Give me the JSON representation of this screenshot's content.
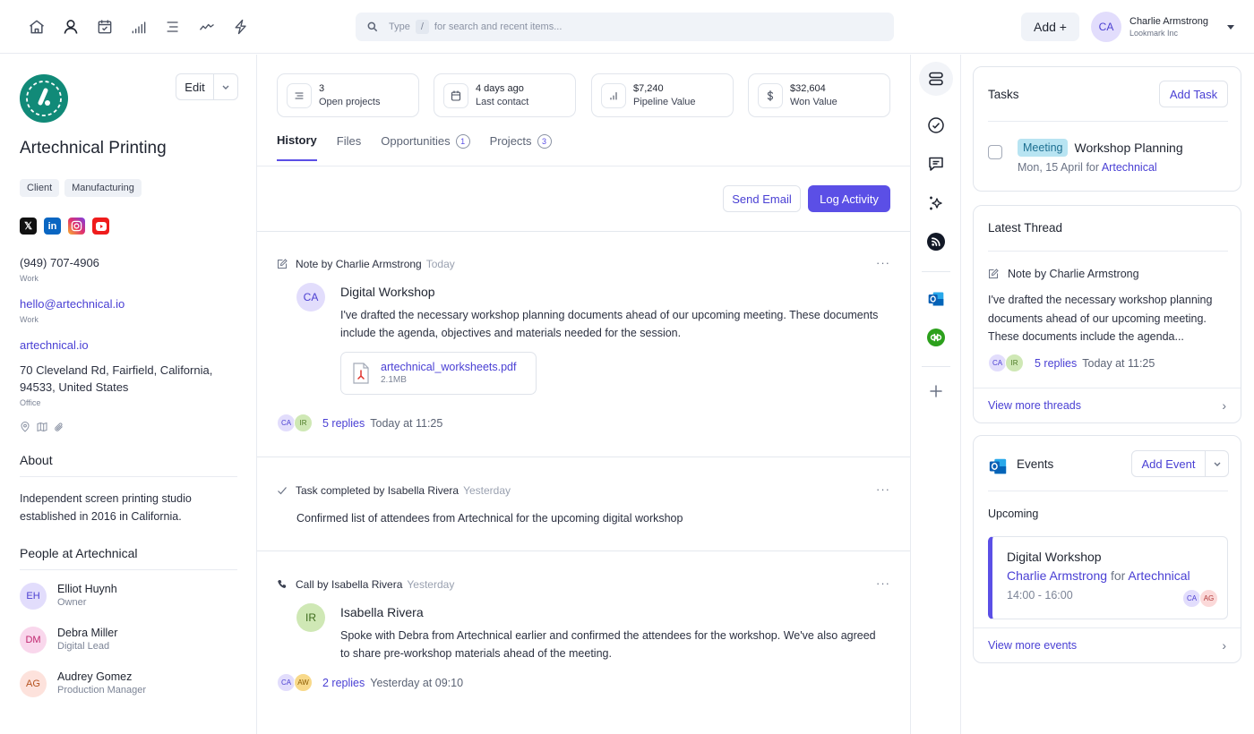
{
  "topbar": {
    "nav_icons": [
      "home-icon",
      "person-icon",
      "calendar-check-icon",
      "bar-chart-icon",
      "list-icon",
      "activity-icon",
      "lightning-icon"
    ],
    "search": {
      "prefix": "Type",
      "shortcut": "/",
      "placeholder": "for search and recent items..."
    },
    "add_label": "Add +",
    "user": {
      "initials": "CA",
      "name": "Charlie Armstrong",
      "org": "Lookmark Inc"
    }
  },
  "company": {
    "name": "Artechnical Printing",
    "logo_color": "#118a78",
    "edit_label": "Edit",
    "tags": [
      "Client",
      "Manufacturing"
    ],
    "socials": [
      "x",
      "linkedin",
      "instagram",
      "youtube"
    ],
    "phone": {
      "value": "(949) 707-4906",
      "label": "Work"
    },
    "email": {
      "value": "hello@artechnical.io",
      "label": "Work"
    },
    "website": "artechnical.io",
    "address": {
      "line1": "70 Cleveland Rd, Fairfield, California,",
      "line2": "94533, United States",
      "label": "Office"
    },
    "about_heading": "About",
    "about": "Independent screen printing studio established in 2016 in California.",
    "people_heading": "People at Artechnical",
    "people": [
      {
        "initials": "EH",
        "name": "Elliot Huynh",
        "role": "Owner",
        "bg": "#e2ddfc",
        "fg": "#4b3fd1"
      },
      {
        "initials": "DM",
        "name": "Debra Miller",
        "role": "Digital Lead",
        "bg": "#f9d7ec",
        "fg": "#c0266f"
      },
      {
        "initials": "AG",
        "name": "Audrey Gomez",
        "role": "Production Manager",
        "bg": "#fde2dc",
        "fg": "#b5521f"
      }
    ]
  },
  "stats": [
    {
      "icon": "list-icon",
      "value": "3",
      "label": "Open projects"
    },
    {
      "icon": "calendar-icon",
      "value": "4 days ago",
      "label": "Last contact"
    },
    {
      "icon": "bar-chart-icon",
      "value": "$7,240",
      "label": "Pipeline Value"
    },
    {
      "icon": "dollar-icon",
      "value": "$32,604",
      "label": "Won Value"
    }
  ],
  "tabs": [
    {
      "label": "History",
      "active": true
    },
    {
      "label": "Files"
    },
    {
      "label": "Opportunities",
      "count": "1"
    },
    {
      "label": "Projects",
      "count": "3"
    }
  ],
  "actions": {
    "send_email": "Send Email",
    "log_activity": "Log Activity"
  },
  "activities": [
    {
      "type": "note",
      "heading": "Note by Charlie Armstrong",
      "when": "Today",
      "avatar": "CA",
      "title": "Digital Workshop",
      "body": "I've drafted the necessary workshop planning documents ahead of our upcoming meeting. These documents include the agenda, objectives and materials needed for the session.",
      "file": {
        "name": "artechnical_worksheets.pdf",
        "size": "2.1MB"
      },
      "reply_avatars": [
        "CA",
        "IR"
      ],
      "replies": "5 replies",
      "reply_time": "Today at 11:25"
    },
    {
      "type": "task",
      "heading": "Task completed by Isabella Rivera",
      "when": "Yesterday",
      "body": "Confirmed list of attendees from Artechnical for the upcoming digital workshop"
    },
    {
      "type": "call",
      "heading": "Call by Isabella Rivera",
      "when": "Yesterday",
      "avatar": "IR",
      "title": "Isabella Rivera",
      "body": "Spoke with Debra from Artechnical earlier and confirmed the attendees for the workshop. We've also agreed to share pre-workshop materials ahead of the meeting.",
      "reply_avatars": [
        "CA",
        "AW"
      ],
      "replies": "2 replies",
      "reply_time": "Yesterday at 09:10"
    }
  ],
  "rail": [
    "layers-icon",
    "check-circle-icon",
    "message-icon",
    "sparkles-icon",
    "feed-icon",
    "outlook-icon",
    "quickbooks-icon",
    "plus-icon"
  ],
  "tasks_card": {
    "title": "Tasks",
    "add_label": "Add Task",
    "items": [
      {
        "badge": "Meeting",
        "title": "Workshop Planning",
        "date": "Mon, 15 April",
        "for_word": "for",
        "company": "Artechnical",
        "done": false
      }
    ]
  },
  "thread_card": {
    "title": "Latest Thread",
    "heading": "Note by Charlie Armstrong",
    "body": "I've drafted the necessary workshop planning documents ahead of our upcoming meeting. These documents include the agenda...",
    "reply_avatars": [
      "CA",
      "IR"
    ],
    "replies": "5 replies",
    "reply_time": "Today at 11:25",
    "more_label": "View more threads"
  },
  "events_card": {
    "title": "Events",
    "add_label": "Add Event",
    "upcoming_label": "Upcoming",
    "event": {
      "title": "Digital Workshop",
      "owner": "Charlie Armstrong",
      "for_word": "for",
      "company": "Artechnical",
      "time": "14:00 - 16:00",
      "attendees": [
        "CA",
        "AG"
      ]
    },
    "more_label": "View more events"
  },
  "colors": {
    "accent": "#5b4fe6",
    "link": "#4a40d4",
    "border": "#e1e5ec"
  }
}
